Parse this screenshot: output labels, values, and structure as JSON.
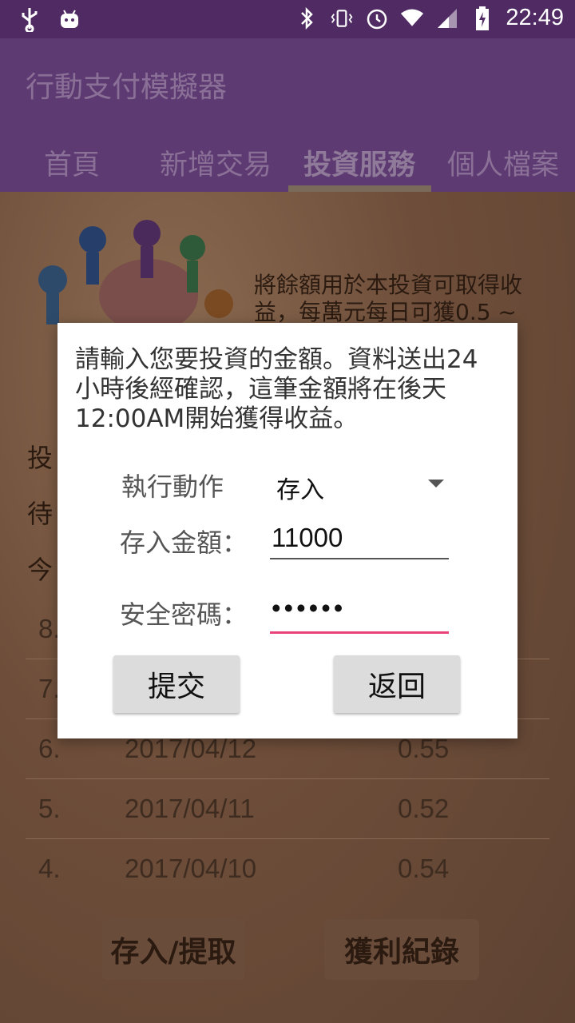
{
  "status_bar": {
    "time": "22:49",
    "icons_left": [
      "usb-icon",
      "android-icon"
    ],
    "icons_right": [
      "bluetooth-icon",
      "vibrate-icon",
      "alarm-icon",
      "wifi-icon",
      "signal-icon",
      "battery-icon"
    ]
  },
  "app": {
    "title": "行動支付模擬器",
    "tabs": [
      "首頁",
      "新增交易",
      "投資服務",
      "個人檔案"
    ],
    "active_tab": "投資服務"
  },
  "page": {
    "description": "將餘額用於本投資可取得收益，每萬元每日可獲0.5 ~",
    "side_labels": [
      "投",
      "待",
      "今"
    ],
    "rows": [
      {
        "n": "8.",
        "date": "",
        "value": ""
      },
      {
        "n": "7.",
        "date": "",
        "value": ""
      },
      {
        "n": "6.",
        "date": "2017/04/12",
        "value": "0.55"
      },
      {
        "n": "5.",
        "date": "2017/04/11",
        "value": "0.52"
      },
      {
        "n": "4.",
        "date": "2017/04/10",
        "value": "0.54"
      }
    ],
    "deposit_withdraw_button": "存入/提取",
    "profit_record_button": "獲利紀錄"
  },
  "dialog": {
    "message": "請輸入您要投資的金額。資料送出24小時後經確認，這筆金額將在後天12:00AM開始獲得收益。",
    "action_label": "執行動作",
    "action_value": "存入",
    "amount_label": "存入金額：",
    "amount_value": "11000",
    "password_label": "安全密碼：",
    "password_mask": "••••••",
    "submit": "提交",
    "back": "返回"
  },
  "colors": {
    "status_bar": "#4f2a63",
    "app_bar": "#5d3a72",
    "focus_underline": "#e8447a"
  }
}
